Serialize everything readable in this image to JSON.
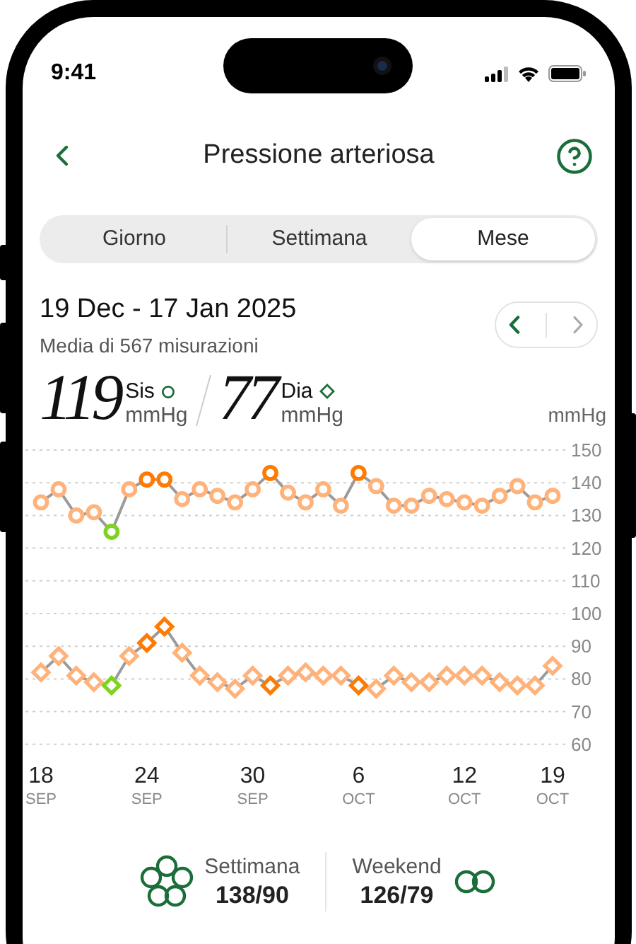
{
  "status_bar": {
    "time": "9:41"
  },
  "header": {
    "title": "Pressione arteriosa"
  },
  "tabs": [
    {
      "label": "Giorno",
      "selected": false
    },
    {
      "label": "Settimana",
      "selected": false
    },
    {
      "label": "Mese",
      "selected": true
    }
  ],
  "period": {
    "range": "19 Dec - 17 Jan 2025",
    "subtitle": "Media di 567 misurazioni",
    "prev_enabled": true,
    "next_enabled": false
  },
  "averages": [
    {
      "value": "119",
      "label": "Sis",
      "unit": "mmHg",
      "kind": "circle"
    },
    {
      "value": "77",
      "label": "Dia",
      "unit": "mmHg",
      "kind": "diamond"
    }
  ],
  "chart": {
    "unit": "mmHg",
    "chart_data": {
      "type": "line",
      "grid": true,
      "categories": [
        "18 SEP",
        null,
        null,
        null,
        null,
        null,
        "24 SEP",
        null,
        null,
        null,
        null,
        null,
        "30 SEP",
        null,
        null,
        null,
        null,
        null,
        "6 OCT",
        null,
        null,
        null,
        null,
        null,
        "12 OCT",
        null,
        null,
        null,
        null,
        "19 OCT"
      ],
      "ylim": [
        60,
        150
      ],
      "yticks": [
        60,
        70,
        80,
        90,
        100,
        110,
        120,
        130,
        140,
        150
      ],
      "series": [
        {
          "color": "#9b9b9b",
          "marker": "circle",
          "values": [
            134,
            138,
            130,
            131,
            125,
            138,
            141,
            141,
            135,
            138,
            136,
            134,
            138,
            143,
            137,
            134,
            138,
            133,
            143,
            139,
            133,
            133,
            136,
            135,
            134,
            133,
            136,
            139,
            134,
            136
          ]
        },
        {
          "color": "#9b9b9b",
          "marker": "diamond",
          "values": [
            82,
            87,
            81,
            79,
            78,
            87,
            91,
            96,
            88,
            81,
            79,
            77,
            81,
            78,
            81,
            82,
            81,
            81,
            78,
            77,
            81,
            79,
            79,
            81,
            81,
            81,
            79,
            78,
            78,
            84
          ]
        }
      ]
    },
    "point_series": [
      {
        "points": [
          {
            "color": "#ffb27a"
          },
          {
            "color": "#ffb27a"
          },
          {
            "color": "#ffb27a"
          },
          {
            "color": "#ffb27a"
          },
          {
            "color": "#7ed321"
          },
          {
            "color": "#ffb27a"
          },
          {
            "color": "#ff7a00"
          },
          {
            "color": "#ff7a00"
          },
          {
            "color": "#ffb27a"
          },
          {
            "color": "#ffb27a"
          },
          {
            "color": "#ffb27a"
          },
          {
            "color": "#ffb27a"
          },
          {
            "color": "#ffb27a"
          },
          {
            "color": "#ff7a00"
          },
          {
            "color": "#ffb27a"
          },
          {
            "color": "#ffb27a"
          },
          {
            "color": "#ffb27a"
          },
          {
            "color": "#ffb27a"
          },
          {
            "color": "#ff7a00"
          },
          {
            "color": "#ffb27a"
          },
          {
            "color": "#ffb27a"
          },
          {
            "color": "#ffb27a"
          },
          {
            "color": "#ffb27a"
          },
          {
            "color": "#ffb27a"
          },
          {
            "color": "#ffb27a"
          },
          {
            "color": "#ffb27a"
          },
          {
            "color": "#ffb27a"
          },
          {
            "color": "#ffb27a"
          },
          {
            "color": "#ffb27a"
          },
          {
            "color": "#ffb27a"
          }
        ]
      },
      {
        "points": [
          {
            "color": "#ffb27a"
          },
          {
            "color": "#ffb27a"
          },
          {
            "color": "#ffb27a"
          },
          {
            "color": "#ffb27a"
          },
          {
            "color": "#7ed321"
          },
          {
            "color": "#ffb27a"
          },
          {
            "color": "#ff7a00"
          },
          {
            "color": "#ff7a00"
          },
          {
            "color": "#ffb27a"
          },
          {
            "color": "#ffb27a"
          },
          {
            "color": "#ffb27a"
          },
          {
            "color": "#ffb27a"
          },
          {
            "color": "#ffb27a"
          },
          {
            "color": "#ff7a00"
          },
          {
            "color": "#ffb27a"
          },
          {
            "color": "#ffb27a"
          },
          {
            "color": "#ffb27a"
          },
          {
            "color": "#ffb27a"
          },
          {
            "color": "#ff7a00"
          },
          {
            "color": "#ffb27a"
          },
          {
            "color": "#ffb27a"
          },
          {
            "color": "#ffb27a"
          },
          {
            "color": "#ffb27a"
          },
          {
            "color": "#ffb27a"
          },
          {
            "color": "#ffb27a"
          },
          {
            "color": "#ffb27a"
          },
          {
            "color": "#ffb27a"
          },
          {
            "color": "#ffb27a"
          },
          {
            "color": "#ffb27a"
          },
          {
            "color": "#ffb27a"
          }
        ]
      }
    ]
  },
  "summary": [
    {
      "kind": "flower",
      "label": "Settimana",
      "value": "138/90"
    },
    {
      "kind": "pair",
      "label": "Weekend",
      "value": "126/79"
    }
  ]
}
